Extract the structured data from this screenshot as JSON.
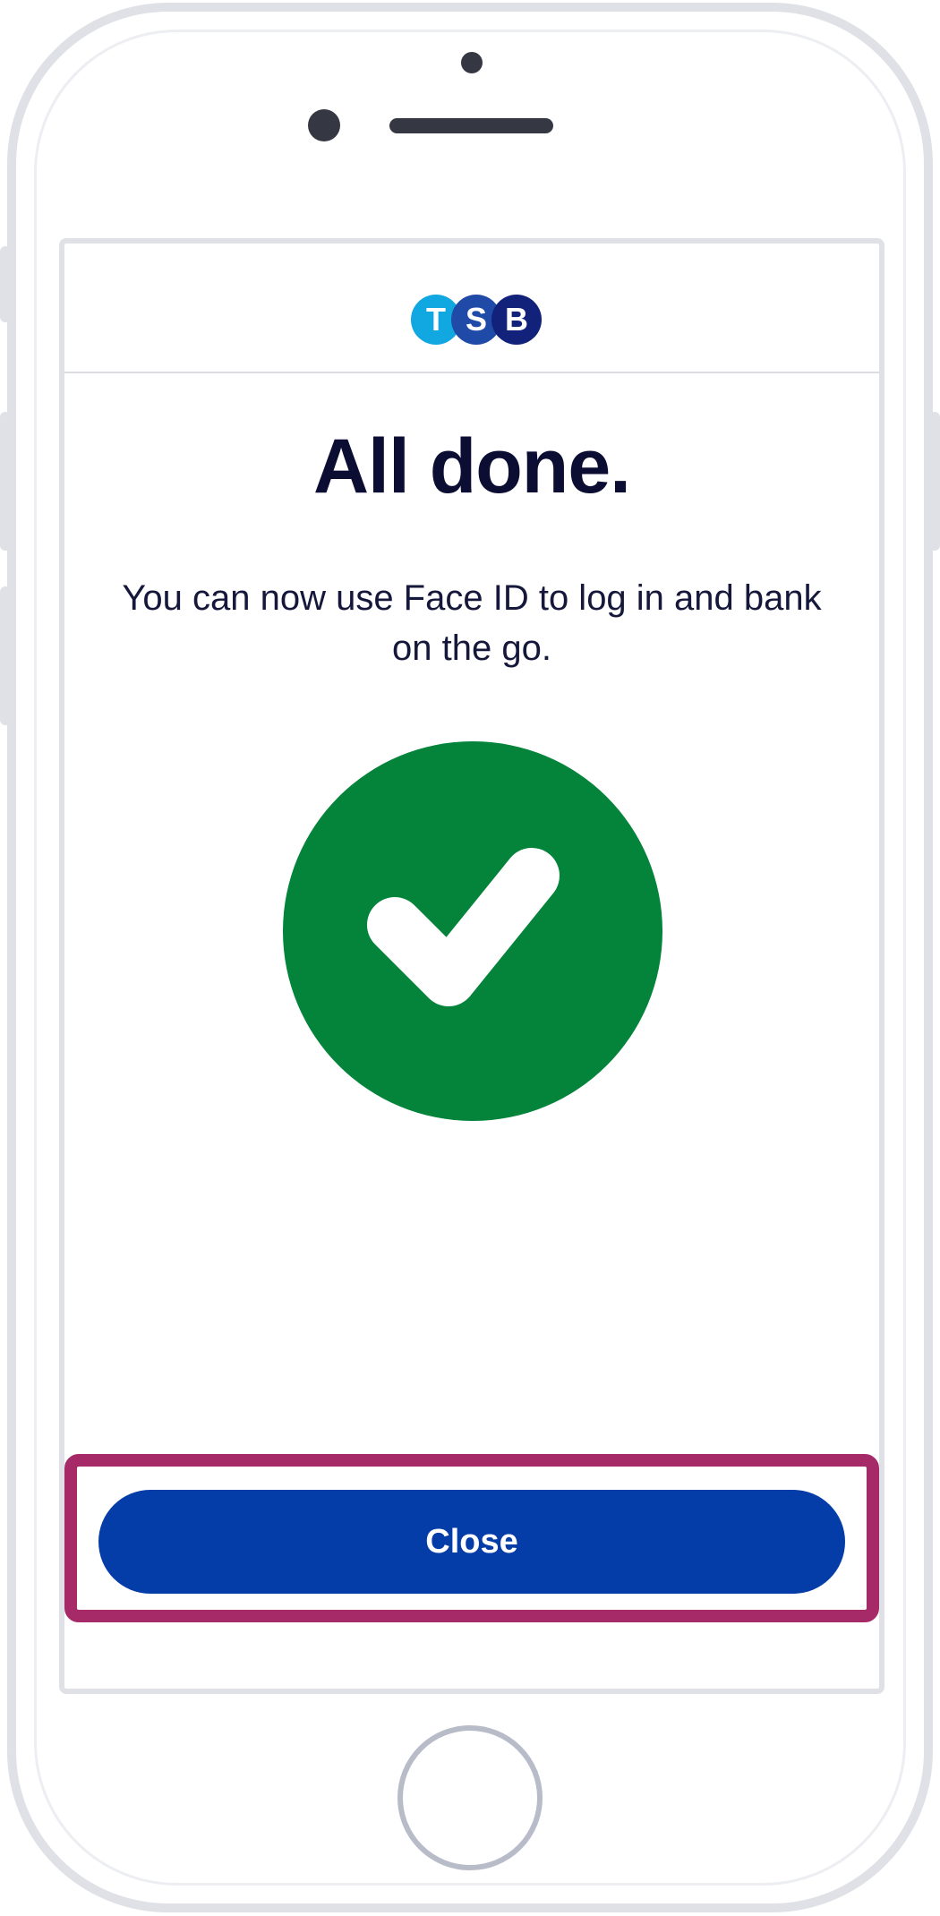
{
  "brand": {
    "logo_letters": [
      "T",
      "S",
      "B"
    ],
    "colors": {
      "t": "#11a7e0",
      "s": "#1f4aa8",
      "b": "#12227a"
    }
  },
  "content": {
    "title": "All done.",
    "message": "You can now use Face ID to log in and bank on the go.",
    "status_icon": "checkmark-circle-icon",
    "status_color": "#04843a"
  },
  "actions": {
    "close_label": "Close",
    "close_color": "#053da8",
    "highlight_color": "#a62968"
  }
}
